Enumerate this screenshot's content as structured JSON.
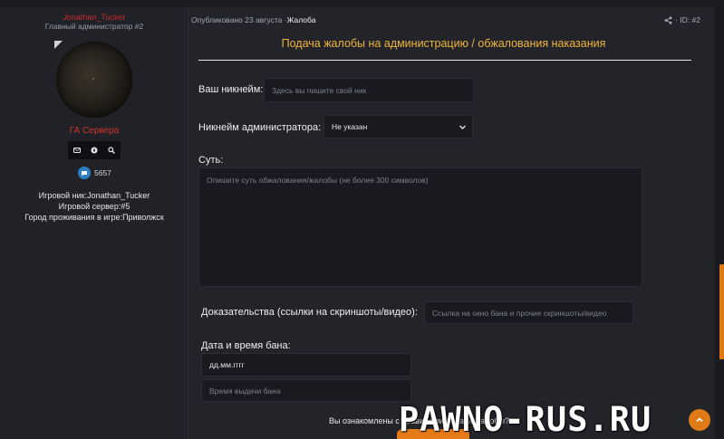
{
  "user": {
    "name": "Jonathan_Tucker",
    "title": "Главный администратор #2",
    "rank": "ГА Сервера",
    "messages": "5657",
    "game_nick_label": "Игровой ник:",
    "game_nick": "Jonathan_Tucker",
    "server_label": "Игровой сервер:",
    "server": "#5",
    "city_label": "Город проживания в игре:",
    "city": "Приволжск"
  },
  "post": {
    "published_prefix": "Опубликовано",
    "date": "23 августа",
    "separator": "·",
    "thread": "Жалоба",
    "id_label": "· ID: #2"
  },
  "form": {
    "title": "Подача жалобы на администрацию / обжалования наказания",
    "nickname_label": "Ваш никнейм:",
    "nickname_placeholder": "Здесь вы пишите свой ник",
    "admin_label": "Никнейм администратора:",
    "admin_selected": "Не указан",
    "essence_label": "Суть:",
    "essence_placeholder": "Опишите суть обжалования/жалобы (не более 300 символов)",
    "evidence_label": "Доказательства (ссылки на скриншоты/видео):",
    "evidence_placeholder": "Ссылка на окно бана и прочие скриншоты/видео",
    "ban_date_label": "Дата и время бана:",
    "ban_date_value": "дд.мм.гггг",
    "ban_time_placeholder": "Время выдачи бана",
    "footer_question": "Вы ознакомлены с правилами подачи жалобы?"
  },
  "watermark": "PAWNO-RUS.RU",
  "colors": {
    "accent_orange": "#e07a16",
    "title_gold": "#f0b53a",
    "username_red": "#c92a2a"
  },
  "icons": [
    "online-indicator-icon",
    "message-icon",
    "compass-icon",
    "search-icon",
    "speech-bubble-icon",
    "share-icon",
    "chevron-down-icon",
    "arrow-up-icon"
  ]
}
